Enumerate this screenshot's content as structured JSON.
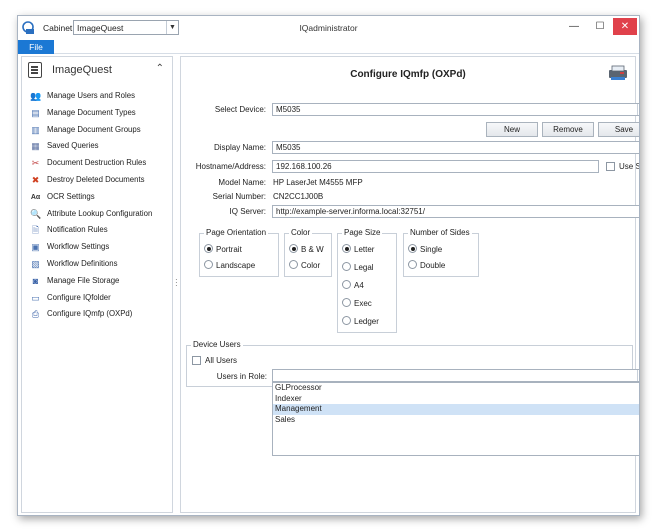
{
  "window": {
    "title": "IQadministrator",
    "cabinet_label": "Cabinet:",
    "cabinet_value": "ImageQuest",
    "controls": {
      "minimize": "—",
      "maximize": "☐",
      "close": "✕"
    }
  },
  "menu": {
    "file": "File"
  },
  "sidebar": {
    "header": "ImageQuest",
    "items": [
      {
        "label": "Manage Users and Roles",
        "icon": "users-icon"
      },
      {
        "label": "Manage Document Types",
        "icon": "document-types-icon"
      },
      {
        "label": "Manage Document Groups",
        "icon": "document-groups-icon"
      },
      {
        "label": "Saved Queries",
        "icon": "saved-queries-icon"
      },
      {
        "label": "Document Destruction Rules",
        "icon": "destruction-rules-icon"
      },
      {
        "label": "Destroy Deleted Documents",
        "icon": "destroy-icon"
      },
      {
        "label": "OCR Settings",
        "icon": "ocr-icon"
      },
      {
        "label": "Attribute Lookup Configuration",
        "icon": "lookup-icon"
      },
      {
        "label": "Notification Rules",
        "icon": "notification-icon"
      },
      {
        "label": "Workflow Settings",
        "icon": "workflow-settings-icon"
      },
      {
        "label": "Workflow Definitions",
        "icon": "workflow-definitions-icon"
      },
      {
        "label": "Manage File Storage",
        "icon": "file-storage-icon"
      },
      {
        "label": "Configure IQfolder",
        "icon": "iqfolder-icon"
      },
      {
        "label": "Configure IQmfp (OXPd)",
        "icon": "iqmfp-icon"
      }
    ]
  },
  "main": {
    "title": "Configure IQmfp (OXPd)",
    "select_device_label": "Select Device:",
    "select_device_value": "M5035",
    "buttons": {
      "new": "New",
      "remove": "Remove",
      "save": "Save"
    },
    "display_name_label": "Display Name:",
    "display_name_value": "M5035",
    "hostname_label": "Hostname/Address:",
    "hostname_value": "192.168.100.26",
    "use_ssl_label": "Use SSL",
    "model_label": "Model Name:",
    "model_value": "HP LaserJet M4555 MFP",
    "serial_label": "Serial Number:",
    "serial_value": "CN2CC1J00B",
    "iq_server_label": "IQ Server:",
    "iq_server_value": "http://example-server.informa.local:32751/",
    "orientation": {
      "title": "Page Orientation",
      "options": [
        "Portrait",
        "Landscape"
      ],
      "selected": "Portrait"
    },
    "color": {
      "title": "Color",
      "options": [
        "B & W",
        "Color"
      ],
      "selected": "B & W"
    },
    "page_size": {
      "title": "Page Size",
      "options": [
        "Letter",
        "Legal",
        "A4",
        "Exec",
        "Ledger"
      ],
      "selected": "Letter"
    },
    "sides": {
      "title": "Number of Sides",
      "options": [
        "Single",
        "Double"
      ],
      "selected": "Single"
    },
    "device_users": {
      "title": "Device Users",
      "all_users_label": "All Users",
      "users_in_role_label": "Users in Role:",
      "users_in_role_value": "",
      "role_options": [
        "GLProcessor",
        "Indexer",
        "Management",
        "Sales"
      ],
      "highlighted": "Management"
    }
  }
}
